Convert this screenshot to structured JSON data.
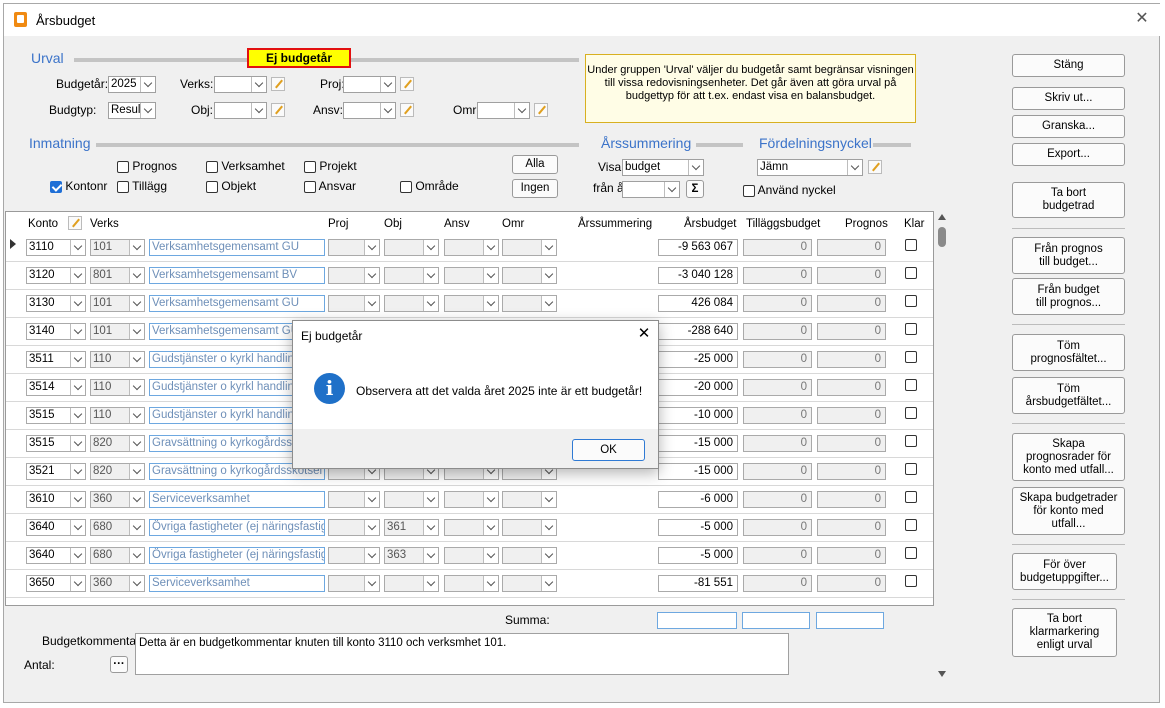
{
  "window": {
    "title": "Årsbudget"
  },
  "urval": {
    "section_label": "Urval",
    "warning_badge": "Ej budgetår",
    "budgetar_label": "Budgetår:",
    "budgetar_value": "2025",
    "budgtyp_label": "Budgtyp:",
    "budgtyp_value": "Resultat",
    "verks_label": "Verks:",
    "obj_label": "Obj:",
    "proj_label": "Proj:",
    "ansv_label": "Ansv:",
    "omr_label": "Omr:",
    "info_text": "Under gruppen 'Urval' väljer du budgetår samt begränsar visningen till vissa redovisningsenheter. Det går även att göra urval på budgettyp för att t.ex. endast visa en balansbudget."
  },
  "inmatning": {
    "section_label": "Inmatning",
    "checkboxes": [
      {
        "label": "Prognos",
        "checked": false
      },
      {
        "label": "Verksamhet",
        "checked": false
      },
      {
        "label": "Projekt",
        "checked": false
      },
      {
        "label": "Kontonr",
        "checked": true
      },
      {
        "label": "Tillägg",
        "checked": false
      },
      {
        "label": "Objekt",
        "checked": false
      },
      {
        "label": "Ansvar",
        "checked": false
      },
      {
        "label": "Område",
        "checked": false
      }
    ],
    "alla_button": "Alla",
    "ingen_button": "Ingen"
  },
  "arssummering": {
    "section_label": "Årssummering",
    "visa_label": "Visa:",
    "visa_value": "budget",
    "fran_ar_label": "från år",
    "sum_icon": "Σ"
  },
  "fordelningsnyckel": {
    "section_label": "Fördelningsnyckel",
    "value": "Jämn",
    "use_key_label": "Använd nyckel",
    "use_key_checked": false
  },
  "grid": {
    "columns": [
      "Konto",
      "Verks",
      "Proj",
      "Obj",
      "Ansv",
      "Omr",
      "Årssummering",
      "Årsbudget",
      "Tilläggsbudget",
      "Prognos",
      "Klar"
    ],
    "rows": [
      {
        "konto": "3110",
        "verks": "101",
        "verks_name": "Verksamhetsgemensamt GU",
        "obj": "",
        "arsbudget": "-9 563 067",
        "tillagg": "0",
        "prognos": "0"
      },
      {
        "konto": "3120",
        "verks": "801",
        "verks_name": "Verksamhetsgemensamt BV",
        "obj": "",
        "arsbudget": "-3 040 128",
        "tillagg": "0",
        "prognos": "0"
      },
      {
        "konto": "3130",
        "verks": "101",
        "verks_name": "Verksamhetsgemensamt GU",
        "obj": "",
        "arsbudget": "426 084",
        "tillagg": "0",
        "prognos": "0"
      },
      {
        "konto": "3140",
        "verks": "101",
        "verks_name": "Verksamhetsgemensamt GU",
        "obj": "",
        "arsbudget": "-288 640",
        "tillagg": "0",
        "prognos": "0"
      },
      {
        "konto": "3511",
        "verks": "110",
        "verks_name": "Gudstjänster o kyrkl handlinga",
        "obj": "",
        "arsbudget": "-25 000",
        "tillagg": "0",
        "prognos": "0"
      },
      {
        "konto": "3514",
        "verks": "110",
        "verks_name": "Gudstjänster o kyrkl handlinga",
        "obj": "",
        "arsbudget": "-20 000",
        "tillagg": "0",
        "prognos": "0"
      },
      {
        "konto": "3515",
        "verks": "110",
        "verks_name": "Gudstjänster o kyrkl handlinga",
        "obj": "",
        "arsbudget": "-10 000",
        "tillagg": "0",
        "prognos": "0"
      },
      {
        "konto": "3515",
        "verks": "820",
        "verks_name": "Gravsättning o kyrkogårdsskötsel",
        "obj": "",
        "arsbudget": "-15 000",
        "tillagg": "0",
        "prognos": "0"
      },
      {
        "konto": "3521",
        "verks": "820",
        "verks_name": "Gravsättning o kyrkogårdsskötsel",
        "obj": "",
        "arsbudget": "-15 000",
        "tillagg": "0",
        "prognos": "0"
      },
      {
        "konto": "3610",
        "verks": "360",
        "verks_name": "Serviceverksamhet",
        "obj": "",
        "arsbudget": "-6 000",
        "tillagg": "0",
        "prognos": "0"
      },
      {
        "konto": "3640",
        "verks": "680",
        "verks_name": "Övriga fastigheter (ej näringsfastighe",
        "obj": "361",
        "arsbudget": "-5 000",
        "tillagg": "0",
        "prognos": "0"
      },
      {
        "konto": "3640",
        "verks": "680",
        "verks_name": "Övriga fastigheter (ej näringsfastighe",
        "obj": "363",
        "arsbudget": "-5 000",
        "tillagg": "0",
        "prognos": "0"
      },
      {
        "konto": "3650",
        "verks": "360",
        "verks_name": "Serviceverksamhet",
        "obj": "",
        "arsbudget": "-81 551",
        "tillagg": "0",
        "prognos": "0"
      }
    ],
    "summa_label": "Summa:"
  },
  "footer": {
    "budgetkommentar_label": "Budgetkommentar:",
    "budgetkommentar_value": "Detta är en budgetkommentar knuten till konto 3110 och verksmhet 101.",
    "antal_label": "Antal:",
    "antal_button": "···"
  },
  "right_buttons": {
    "stang": "Stäng",
    "skriv_ut": "Skriv ut...",
    "granska": "Granska...",
    "export": "Export...",
    "ta_bort_budgetrad": "Ta bort budgetrad",
    "fran_prognos": "Från prognos till budget...",
    "fran_budget": "Från budget till prognos...",
    "tom_prognos": "Töm prognosfältet...",
    "tom_arsbudget": "Töm årsbudgetfältet...",
    "skapa_prognosrader": "Skapa prognosrader för konto med utfall...",
    "skapa_budgetrader": "Skapa budgetrader för konto med utfall...",
    "for_over": "För över budgetuppgifter...",
    "ta_bort_klar": "Ta bort klarmarkering enligt urval"
  },
  "dialog": {
    "title": "Ej budgetår",
    "message": "Observera att det valda året 2025 inte är ett budgetår!",
    "ok_button": "OK",
    "icon": "info-icon"
  }
}
